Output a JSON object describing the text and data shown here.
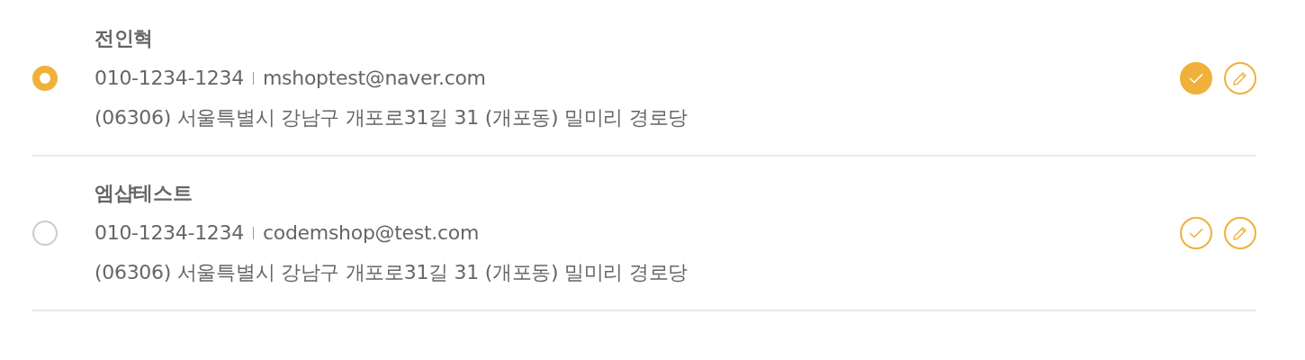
{
  "addresses": [
    {
      "name": "전인혁",
      "phone": "010-1234-1234",
      "email": "mshoptest@naver.com",
      "address": "(06306) 서울특별시 강남구 개포로31길 31 (개포동) 밀미리 경로당",
      "selected": true,
      "default": true
    },
    {
      "name": "엠샵테스트",
      "phone": "010-1234-1234",
      "email": "codemshop@test.com",
      "address": "(06306) 서울특별시 강남구 개포로31길 31 (개포동) 밀미리 경로당",
      "selected": false,
      "default": false
    }
  ]
}
